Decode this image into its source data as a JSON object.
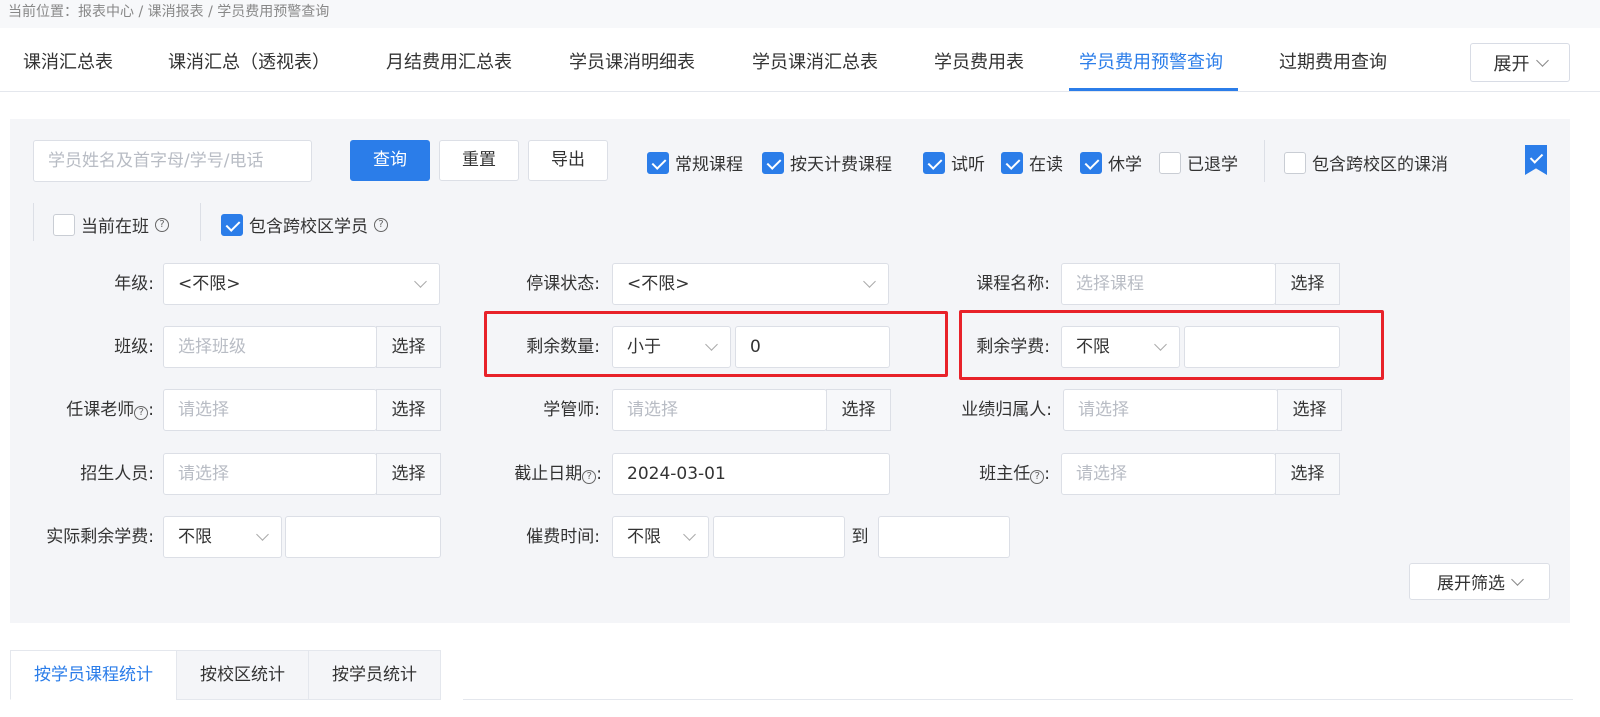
{
  "breadcrumb": "当前位置：报表中心 / 课消报表 / 学员费用预警查询",
  "tabs": [
    {
      "label": "课消汇总表"
    },
    {
      "label": "课消汇总（透视表）"
    },
    {
      "label": "月结费用汇总表"
    },
    {
      "label": "学员课消明细表"
    },
    {
      "label": "学员课消汇总表"
    },
    {
      "label": "学员费用表"
    },
    {
      "label": "学员费用预警查询",
      "active": true
    },
    {
      "label": "过期费用查询"
    }
  ],
  "expand_label": "展开",
  "search": {
    "placeholder": "学员姓名及首字母/学号/电话"
  },
  "buttons": {
    "query": "查询",
    "reset": "重置",
    "export": "导出"
  },
  "checkboxes": [
    {
      "label": "常规课程",
      "checked": true
    },
    {
      "label": "按天计费课程",
      "checked": true
    },
    {
      "label": "试听",
      "checked": true
    },
    {
      "label": "在读",
      "checked": true
    },
    {
      "label": "休学",
      "checked": true
    },
    {
      "label": "已退学",
      "checked": false
    },
    {
      "label": "包含跨校区的课消",
      "checked": false
    },
    {
      "label": "当前在班",
      "checked": false,
      "help": true
    },
    {
      "label": "包含跨校区学员",
      "checked": true,
      "help": true
    }
  ],
  "help_glyph": "?",
  "choose_label": "选择",
  "form": {
    "grade": {
      "label": "年级:",
      "value": "<不限>"
    },
    "suspend_status": {
      "label": "停课状态:",
      "value": "<不限>"
    },
    "course_name": {
      "label": "课程名称:",
      "placeholder": "选择课程"
    },
    "class": {
      "label": "班级:",
      "placeholder": "选择班级"
    },
    "remaining_qty": {
      "label": "剩余数量:",
      "op": "小于",
      "value": "0"
    },
    "remaining_fee": {
      "label": "剩余学费:",
      "op": "不限",
      "value": ""
    },
    "teacher": {
      "label": "任课老师",
      "placeholder": "请选择"
    },
    "tutor": {
      "label": "学管师:",
      "placeholder": "请选择"
    },
    "performance_owner": {
      "label": "业绩归属人:",
      "placeholder": "请选择"
    },
    "recruiter": {
      "label": "招生人员:",
      "placeholder": "请选择"
    },
    "cutoff_date": {
      "label": "截止日期",
      "value": "2024-03-01"
    },
    "head_teacher": {
      "label": "班主任",
      "placeholder": "请选择"
    },
    "actual_remaining_fee": {
      "label": "实际剩余学费:",
      "op": "不限",
      "value": ""
    },
    "dunning_time": {
      "label": "催费时间:",
      "op": "不限",
      "from": "",
      "to_label": "到",
      "to": ""
    }
  },
  "expand_filter_label": "展开筛选",
  "bottom_tabs": [
    {
      "label": "按学员课程统计",
      "active": true
    },
    {
      "label": "按校区统计"
    },
    {
      "label": "按学员统计"
    }
  ],
  "colors": {
    "accent": "#2b7de9",
    "highlight": "#e8222a",
    "panel": "#f4f5f8"
  }
}
